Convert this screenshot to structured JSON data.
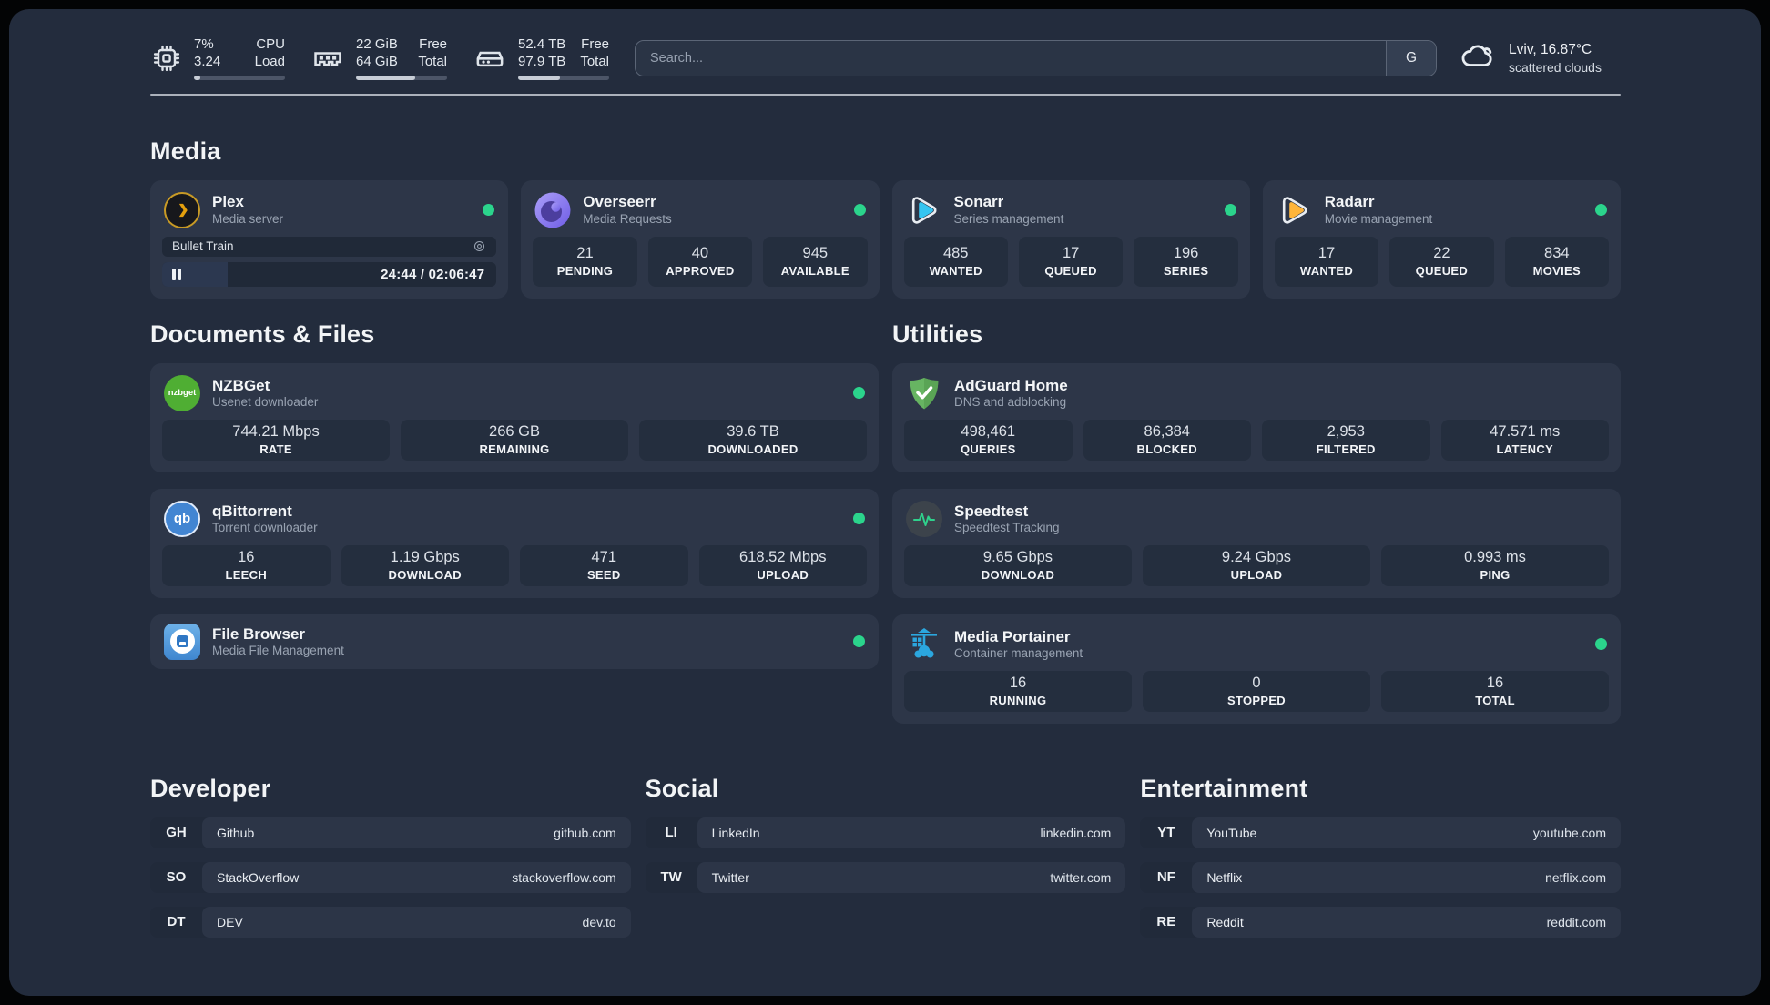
{
  "topbar": {
    "cpu": {
      "percent": "7%",
      "load": "3.24",
      "label1": "CPU",
      "label2": "Load",
      "progress": 7
    },
    "ram": {
      "free": "22 GiB",
      "total": "64 GiB",
      "label1": "Free",
      "label2": "Total",
      "progress": 65
    },
    "disk": {
      "free": "52.4 TB",
      "total": "97.9 TB",
      "label1": "Free",
      "label2": "Total",
      "progress": 46
    },
    "search": {
      "placeholder": "Search...",
      "engine": "G"
    },
    "weather": {
      "summary": "Lviv, 16.87°C",
      "condition": "scattered clouds"
    }
  },
  "sections": {
    "media": "Media",
    "documents": "Documents & Files",
    "utilities": "Utilities",
    "developer": "Developer",
    "social": "Social",
    "entertainment": "Entertainment"
  },
  "services": {
    "plex": {
      "name": "Plex",
      "subtitle": "Media server",
      "player_title": "Bullet Train",
      "player_time": "24:44 / 02:06:47",
      "progress": 19.5
    },
    "overseerr": {
      "name": "Overseerr",
      "subtitle": "Media Requests",
      "stats": [
        {
          "value": "21",
          "label": "PENDING"
        },
        {
          "value": "40",
          "label": "APPROVED"
        },
        {
          "value": "945",
          "label": "AVAILABLE"
        }
      ]
    },
    "sonarr": {
      "name": "Sonarr",
      "subtitle": "Series management",
      "stats": [
        {
          "value": "485",
          "label": "WANTED"
        },
        {
          "value": "17",
          "label": "QUEUED"
        },
        {
          "value": "196",
          "label": "SERIES"
        }
      ]
    },
    "radarr": {
      "name": "Radarr",
      "subtitle": "Movie management",
      "stats": [
        {
          "value": "17",
          "label": "WANTED"
        },
        {
          "value": "22",
          "label": "QUEUED"
        },
        {
          "value": "834",
          "label": "MOVIES"
        }
      ]
    },
    "nzbget": {
      "name": "NZBGet",
      "subtitle": "Usenet downloader",
      "icon_text": "nzbget",
      "stats": [
        {
          "value": "744.21 Mbps",
          "label": "RATE"
        },
        {
          "value": "266 GB",
          "label": "REMAINING"
        },
        {
          "value": "39.6 TB",
          "label": "DOWNLOADED"
        }
      ]
    },
    "qbittorrent": {
      "name": "qBittorrent",
      "subtitle": "Torrent downloader",
      "icon_text": "qb",
      "stats": [
        {
          "value": "16",
          "label": "LEECH"
        },
        {
          "value": "1.19 Gbps",
          "label": "DOWNLOAD"
        },
        {
          "value": "471",
          "label": "SEED"
        },
        {
          "value": "618.52 Mbps",
          "label": "UPLOAD"
        }
      ]
    },
    "filebrowser": {
      "name": "File Browser",
      "subtitle": "Media File Management"
    },
    "adguard": {
      "name": "AdGuard Home",
      "subtitle": "DNS and adblocking",
      "stats": [
        {
          "value": "498,461",
          "label": "QUERIES"
        },
        {
          "value": "86,384",
          "label": "BLOCKED"
        },
        {
          "value": "2,953",
          "label": "FILTERED"
        },
        {
          "value": "47.571 ms",
          "label": "LATENCY"
        }
      ]
    },
    "speedtest": {
      "name": "Speedtest",
      "subtitle": "Speedtest Tracking",
      "stats": [
        {
          "value": "9.65 Gbps",
          "label": "DOWNLOAD"
        },
        {
          "value": "9.24 Gbps",
          "label": "UPLOAD"
        },
        {
          "value": "0.993 ms",
          "label": "PING"
        }
      ]
    },
    "portainer": {
      "name": "Media Portainer",
      "subtitle": "Container management",
      "stats": [
        {
          "value": "16",
          "label": "RUNNING"
        },
        {
          "value": "0",
          "label": "STOPPED"
        },
        {
          "value": "16",
          "label": "TOTAL"
        }
      ]
    }
  },
  "bookmarks": {
    "developer": [
      {
        "abbr": "GH",
        "name": "Github",
        "url": "github.com"
      },
      {
        "abbr": "SO",
        "name": "StackOverflow",
        "url": "stackoverflow.com"
      },
      {
        "abbr": "DT",
        "name": "DEV",
        "url": "dev.to"
      }
    ],
    "social": [
      {
        "abbr": "LI",
        "name": "LinkedIn",
        "url": "linkedin.com"
      },
      {
        "abbr": "TW",
        "name": "Twitter",
        "url": "twitter.com"
      }
    ],
    "entertainment": [
      {
        "abbr": "YT",
        "name": "YouTube",
        "url": "youtube.com"
      },
      {
        "abbr": "NF",
        "name": "Netflix",
        "url": "netflix.com"
      },
      {
        "abbr": "RE",
        "name": "Reddit",
        "url": "reddit.com"
      }
    ]
  },
  "colors": {
    "online": "#2bd48c",
    "plex_accent": "#e5a00d",
    "sonarr_accent": "#35c5f1",
    "radarr_accent": "#ffb53a"
  }
}
